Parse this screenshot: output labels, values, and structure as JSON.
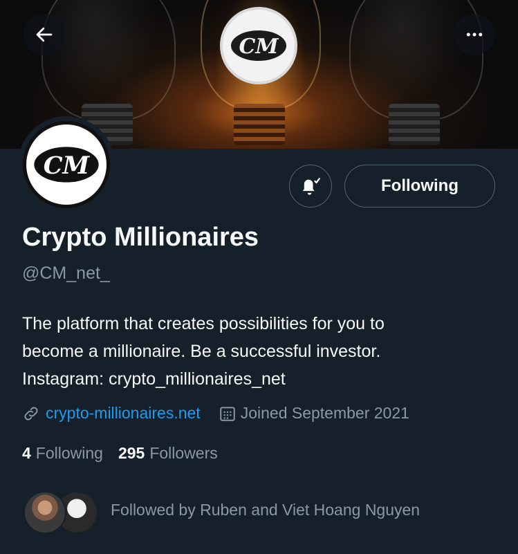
{
  "header": {
    "back_icon": "arrow-left-icon",
    "more_icon": "more-horizontal-icon",
    "banner_logo_text": "CM"
  },
  "profile": {
    "avatar_logo_text": "CM",
    "name": "Crypto Millionaires",
    "handle": "@CM_net_",
    "bio_lines": [
      "The platform that creates possibilities for you to",
      "become a millionaire. Be a successful investor.",
      "Instagram: crypto_millionaires_net"
    ],
    "link_icon": "link-icon",
    "website": "crypto-millionaires.net",
    "calendar_icon": "calendar-icon",
    "joined": "Joined September 2021",
    "following_count": "4",
    "following_label": "Following",
    "followers_count": "295",
    "followers_label": "Followers",
    "followed_by": "Followed by Ruben and Viet Hoang Nguyen"
  },
  "actions": {
    "notify_icon": "bell-check-icon",
    "follow_label": "Following"
  },
  "colors": {
    "background": "#15202b",
    "accent": "#1d9bf0",
    "muted_text": "#8b98a5",
    "border": "#536471"
  }
}
